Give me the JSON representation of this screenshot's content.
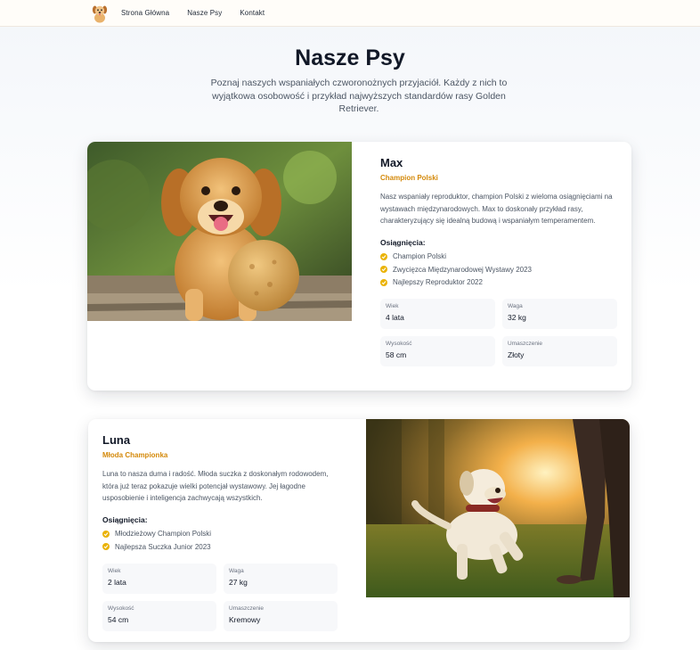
{
  "nav": {
    "logo_icon": "puppy-logo-icon",
    "links": [
      "Strona Główna",
      "Nasze Psy",
      "Kontakt"
    ]
  },
  "hero": {
    "title": "Nasze Psy",
    "subtitle": "Poznaj naszych wspaniałych czworonożnych przyjaciół. Każdy z nich to wyjątkowa osobowość i przykład najwyższych standardów rasy Golden Retriever."
  },
  "colors": {
    "accent": "#d4890a",
    "check": "#eab308",
    "text": "#111827",
    "muted": "#4b5563"
  },
  "dogs": [
    {
      "name": "Max",
      "title": "Champion Polski",
      "description": "Nasz wspaniały reproduktor, champion Polski z wieloma osiągnięciami na wystawach międzynarodowych. Max to doskonały przykład rasy, charakteryzujący się idealną budową i wspaniałym temperamentem.",
      "achievements_heading": "Osiągnięcia:",
      "achievements": [
        "Champion Polski",
        "Zwycięzca Międzynarodowej Wystawy 2023",
        "Najlepszy Reproduktor 2022"
      ],
      "stats": [
        {
          "label": "Wiek",
          "value": "4 lata"
        },
        {
          "label": "Waga",
          "value": "32 kg"
        },
        {
          "label": "Wysokość",
          "value": "58 cm"
        },
        {
          "label": "Umaszczenie",
          "value": "Złoty"
        }
      ]
    },
    {
      "name": "Luna",
      "title": "Młoda Championka",
      "description": "Luna to nasza duma i radość. Młoda suczka z doskonałym rodowodem, która już teraz pokazuje wielki potencjał wystawowy. Jej łagodne usposobienie i inteligencja zachwycają wszystkich.",
      "achievements_heading": "Osiągnięcia:",
      "achievements": [
        "Młodzieżowy Champion Polski",
        "Najlepsza Suczka Junior 2023"
      ],
      "stats": [
        {
          "label": "Wiek",
          "value": "2 lata"
        },
        {
          "label": "Waga",
          "value": "27 kg"
        },
        {
          "label": "Wysokość",
          "value": "54 cm"
        },
        {
          "label": "Umaszczenie",
          "value": "Kremowy"
        }
      ]
    }
  ]
}
